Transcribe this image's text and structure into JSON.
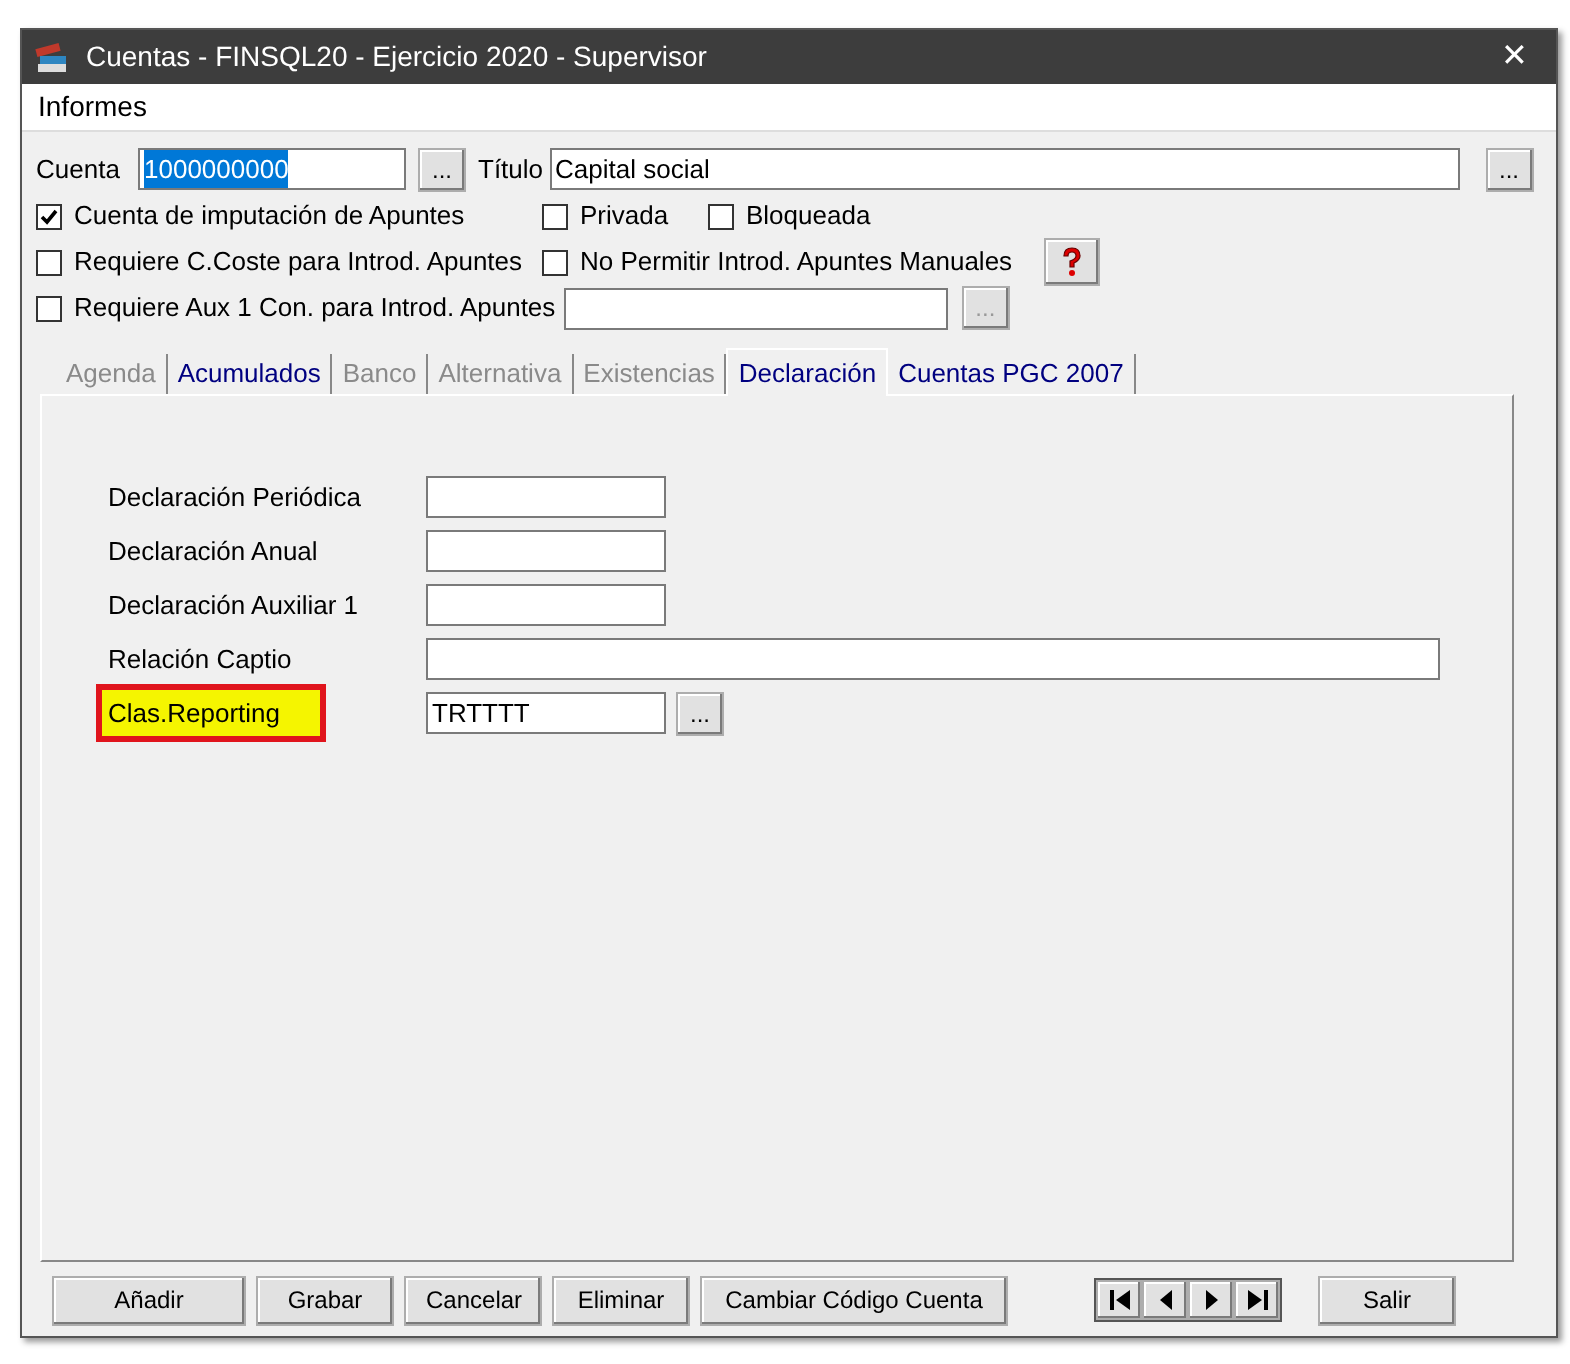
{
  "window": {
    "title": "Cuentas - FINSQL20 - Ejercicio 2020 - Supervisor",
    "close": "✕"
  },
  "menu": [
    "Informes"
  ],
  "cuenta": {
    "label": "Cuenta",
    "value": "1000000000",
    "button": "...",
    "selected_text": true
  },
  "titulo": {
    "label": "Título",
    "value": "Capital social",
    "button": "..."
  },
  "checkboxes": [
    {
      "label": "Cuenta de imputación de Apuntes",
      "checked": true
    },
    {
      "label": "Privada",
      "checked": false
    },
    {
      "label": "Bloqueada",
      "checked": false
    },
    {
      "label": "Requiere C.Coste para Introd. Apuntes",
      "checked": false
    },
    {
      "label": "No Permitir Introd. Apuntes Manuales",
      "checked": false
    },
    {
      "label": "Requiere Aux 1 Con. para Introd. Apuntes",
      "checked": false
    }
  ],
  "aux_field": {
    "button": "...",
    "disabled_button": true
  },
  "tabs": [
    {
      "label": "Agenda",
      "selected": false,
      "disabled": true
    },
    {
      "label": "Acumulados",
      "selected": false,
      "disabled": false
    },
    {
      "label": "Banco",
      "selected": false,
      "disabled": true
    },
    {
      "label": "Alternativa",
      "selected": false,
      "disabled": true
    },
    {
      "label": "Existencias",
      "selected": false,
      "disabled": true
    },
    {
      "label": "Declaración",
      "selected": true,
      "disabled": false
    },
    {
      "label": "Cuentas PGC 2007",
      "selected": false,
      "disabled": false
    }
  ],
  "fields": [
    {
      "label": "Declaración Periódica",
      "kind": "short",
      "highlighted": false
    },
    {
      "label": "Declaración Anual",
      "kind": "short",
      "highlighted": false
    },
    {
      "label": "Declaración Auxiliar 1",
      "kind": "short",
      "highlighted": false
    },
    {
      "label": "Relación Captio",
      "kind": "wide",
      "highlighted": false
    },
    {
      "label": "Clas.Reporting",
      "kind": "lookup",
      "value": "TRTTTT",
      "button": "...",
      "highlighted": true
    }
  ],
  "buttons": [
    "Añadir",
    "Grabar",
    "Cancelar",
    "Eliminar",
    "Cambiar Código Cuenta"
  ],
  "navigation": [
    {
      "kind": "first"
    },
    {
      "kind": "prev"
    },
    {
      "kind": "next"
    },
    {
      "kind": "last"
    }
  ],
  "exit_button": "Salir"
}
